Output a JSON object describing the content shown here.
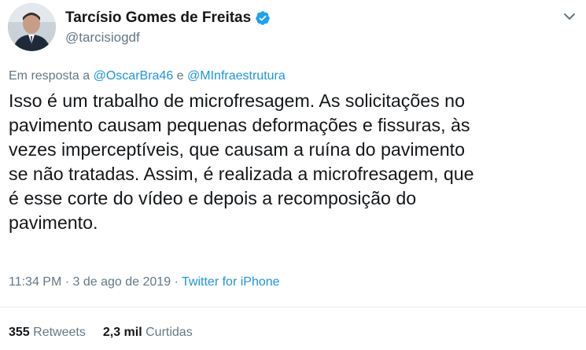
{
  "author": {
    "display_name": "Tarcísio Gomes de Freitas",
    "handle": "@tarcisiogdf",
    "verified": true
  },
  "reply": {
    "prefix": "Em resposta a",
    "mention_1": "@OscarBra46",
    "conjunction": "e",
    "mention_2": "@MInfraestrutura"
  },
  "tweet": {
    "text": "Isso é um trabalho de microfresagem. As solicitações no\npavimento causam pequenas deformações e fissuras, às\nvezes imperceptíveis, que causam a ruína do pavimento\nse não tratadas. Assim, é realizada a microfresagem, que\né esse corte do vídeo e depois a recomposição do\npavimento."
  },
  "meta": {
    "time": "11:34 PM",
    "separator": "·",
    "date": "3 de ago de 2019",
    "source": "Twitter for iPhone"
  },
  "stats": {
    "retweets_count": "355",
    "retweets_label": "Retweets",
    "likes_count": "2,3 mil",
    "likes_label": "Curtidas"
  },
  "colors": {
    "link": "#1b95e0",
    "muted": "#657786",
    "text": "#14171a",
    "verified": "#1da1f2"
  },
  "icons": {
    "verified": "verified-badge-icon",
    "menu": "chevron-down-icon"
  }
}
